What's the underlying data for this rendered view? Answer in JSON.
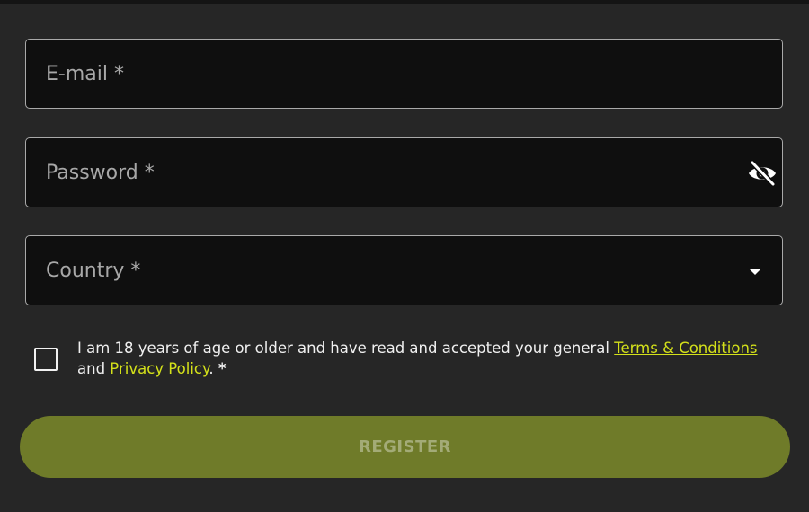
{
  "form": {
    "email": {
      "placeholder": "E-mail *",
      "value": ""
    },
    "password": {
      "placeholder": "Password *",
      "value": "",
      "toggle_icon": "eye-off-icon"
    },
    "country": {
      "placeholder": "Country *",
      "icon": "caret-down-icon"
    },
    "consent": {
      "text_before": "I am 18 years of age or older and have read and accepted your general ",
      "terms_link": "Terms & Conditions",
      "text_middle": " and ",
      "privacy_link": "Privacy Policy",
      "text_after": ". ",
      "required_mark": "*",
      "checked": false
    },
    "register_label": "REGISTER"
  },
  "colors": {
    "background": "#262626",
    "field_background": "#0f0f0f",
    "field_border": "#a9a9a9",
    "link": "#d4e11a",
    "button_background": "#6f7b29",
    "button_text": "#a3ab77"
  }
}
